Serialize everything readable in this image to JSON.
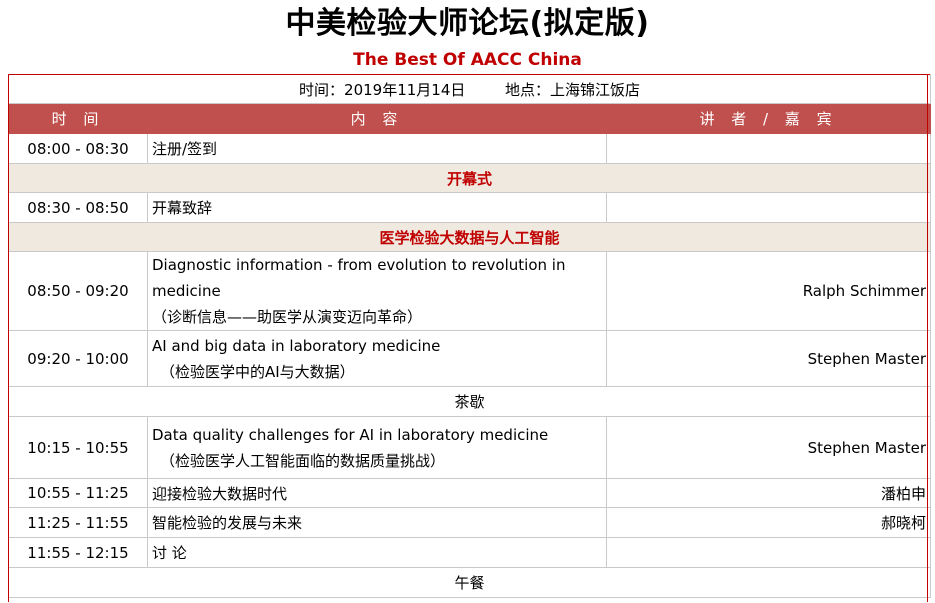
{
  "header": {
    "title": "中美检验大师论坛(拟定版)",
    "subtitle": "The Best Of AACC China"
  },
  "info": {
    "date": "时间：2019年11月14日",
    "venue": "地点：上海锦江饭店"
  },
  "columns": {
    "time": "时 间",
    "content": "内 容",
    "speaker": "讲 者 / 嘉 宾"
  },
  "rows": [
    {
      "time": "08:00 - 08:30",
      "topic": "注册/签到",
      "speaker": ""
    },
    {
      "section": "开幕式"
    },
    {
      "time": "08:30 - 08:50",
      "topic": "开幕致辞",
      "speaker": ""
    },
    {
      "section": "医学检验大数据与人工智能"
    },
    {
      "time": "08:50 - 09:20",
      "topic_en": "Diagnostic information - from evolution to revolution in medicine",
      "topic_zh": "（诊断信息——助医学从演变迈向革命）",
      "speaker": "Ralph Schimmer"
    },
    {
      "time": "09:20 - 10:00",
      "topic_en": "AI and big data in laboratory medicine",
      "topic_zh": "（检验医学中的AI与大数据）",
      "speaker": "Stephen Master"
    },
    {
      "break": "茶歇"
    },
    {
      "time": "10:15 - 10:55",
      "topic_en": "Data quality challenges for AI in laboratory medicine",
      "topic_zh": "（检验医学人工智能面临的数据质量挑战）",
      "speaker": "Stephen Master"
    },
    {
      "time": "10:55 - 11:25",
      "topic": "迎接检验大数据时代",
      "speaker": "潘柏申"
    },
    {
      "time": "11:25 - 11:55",
      "topic": "智能检验的发展与未来",
      "speaker": "郝晓柯"
    },
    {
      "time": "11:55 - 12:15",
      "topic": "讨 论",
      "speaker": ""
    },
    {
      "break": "午餐"
    }
  ]
}
